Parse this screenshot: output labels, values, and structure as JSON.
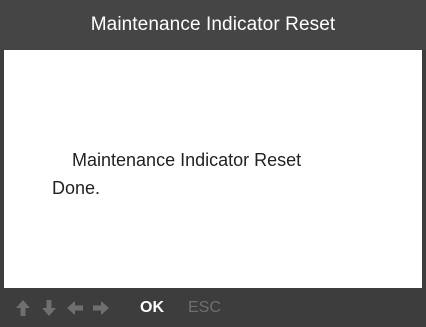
{
  "header": {
    "title": "Maintenance Indicator Reset"
  },
  "content": {
    "message_line1": "    Maintenance Indicator Reset",
    "message_line2": "Done."
  },
  "footer": {
    "icons": [
      "arrow-up-icon",
      "arrow-down-icon",
      "arrow-left-icon",
      "arrow-right-icon"
    ],
    "ok_label": "OK",
    "esc_label": "ESC",
    "icon_color": "#6f6f6f",
    "ok_color": "#ffffff",
    "esc_color": "#6f6f6f"
  },
  "colors": {
    "header_bg": "#454545",
    "frame_bg": "#3d3d3d",
    "content_bg": "#ffffff",
    "text": "#222222"
  }
}
